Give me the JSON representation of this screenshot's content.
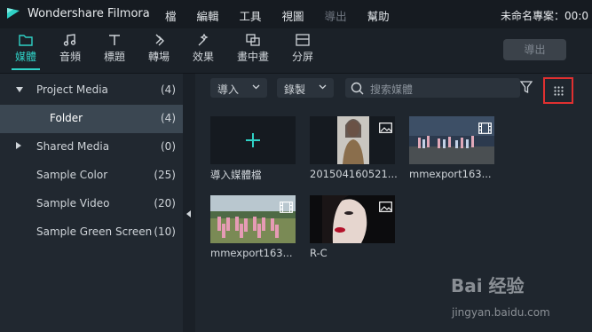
{
  "app": {
    "title": "Wondershare Filmora",
    "project_title": "未命名專案：00:0"
  },
  "menu": [
    {
      "label": "檔",
      "disabled": false
    },
    {
      "label": "編輯",
      "disabled": false
    },
    {
      "label": "工具",
      "disabled": false
    },
    {
      "label": "視圖",
      "disabled": false
    },
    {
      "label": "導出",
      "disabled": true
    },
    {
      "label": "幫助",
      "disabled": false
    }
  ],
  "toolbar": {
    "tabs": [
      {
        "label": "媒體",
        "icon": "folder-icon"
      },
      {
        "label": "音頻",
        "icon": "music-note-icon"
      },
      {
        "label": "標題",
        "icon": "text-icon"
      },
      {
        "label": "轉場",
        "icon": "transition-icon"
      },
      {
        "label": "效果",
        "icon": "effects-icon"
      },
      {
        "label": "畫中畫",
        "icon": "picture-in-picture-icon"
      },
      {
        "label": "分屏",
        "icon": "split-screen-icon"
      }
    ],
    "active_tab": "媒體",
    "export_label": "導出"
  },
  "sidebar": {
    "items": [
      {
        "label": "Project Media",
        "count": "(4)",
        "expanded": true
      },
      {
        "label": "Folder",
        "count": "(4)",
        "selected": true
      },
      {
        "label": "Shared Media",
        "count": "(0)",
        "expanded": false
      },
      {
        "label": "Sample Color",
        "count": "(25)"
      },
      {
        "label": "Sample Video",
        "count": "(20)"
      },
      {
        "label": "Sample Green Screen",
        "count": "(10)"
      }
    ]
  },
  "media_toolbar": {
    "import_label": "導入",
    "record_label": "錄製",
    "search_placeholder": "搜索媒體"
  },
  "media": {
    "import_tile_label": "導入媒體檔",
    "items": [
      {
        "caption": "201504160521...",
        "type": "image"
      },
      {
        "caption": "mmexport163...",
        "type": "video"
      },
      {
        "caption": "mmexport163...",
        "type": "video"
      },
      {
        "caption": "R-C",
        "type": "image"
      }
    ]
  },
  "watermark": {
    "text": "Bai 经验",
    "url": "jingyan.baidu.com"
  },
  "colors": {
    "accent": "#2fd1c6",
    "highlight_box": "#e03030"
  }
}
